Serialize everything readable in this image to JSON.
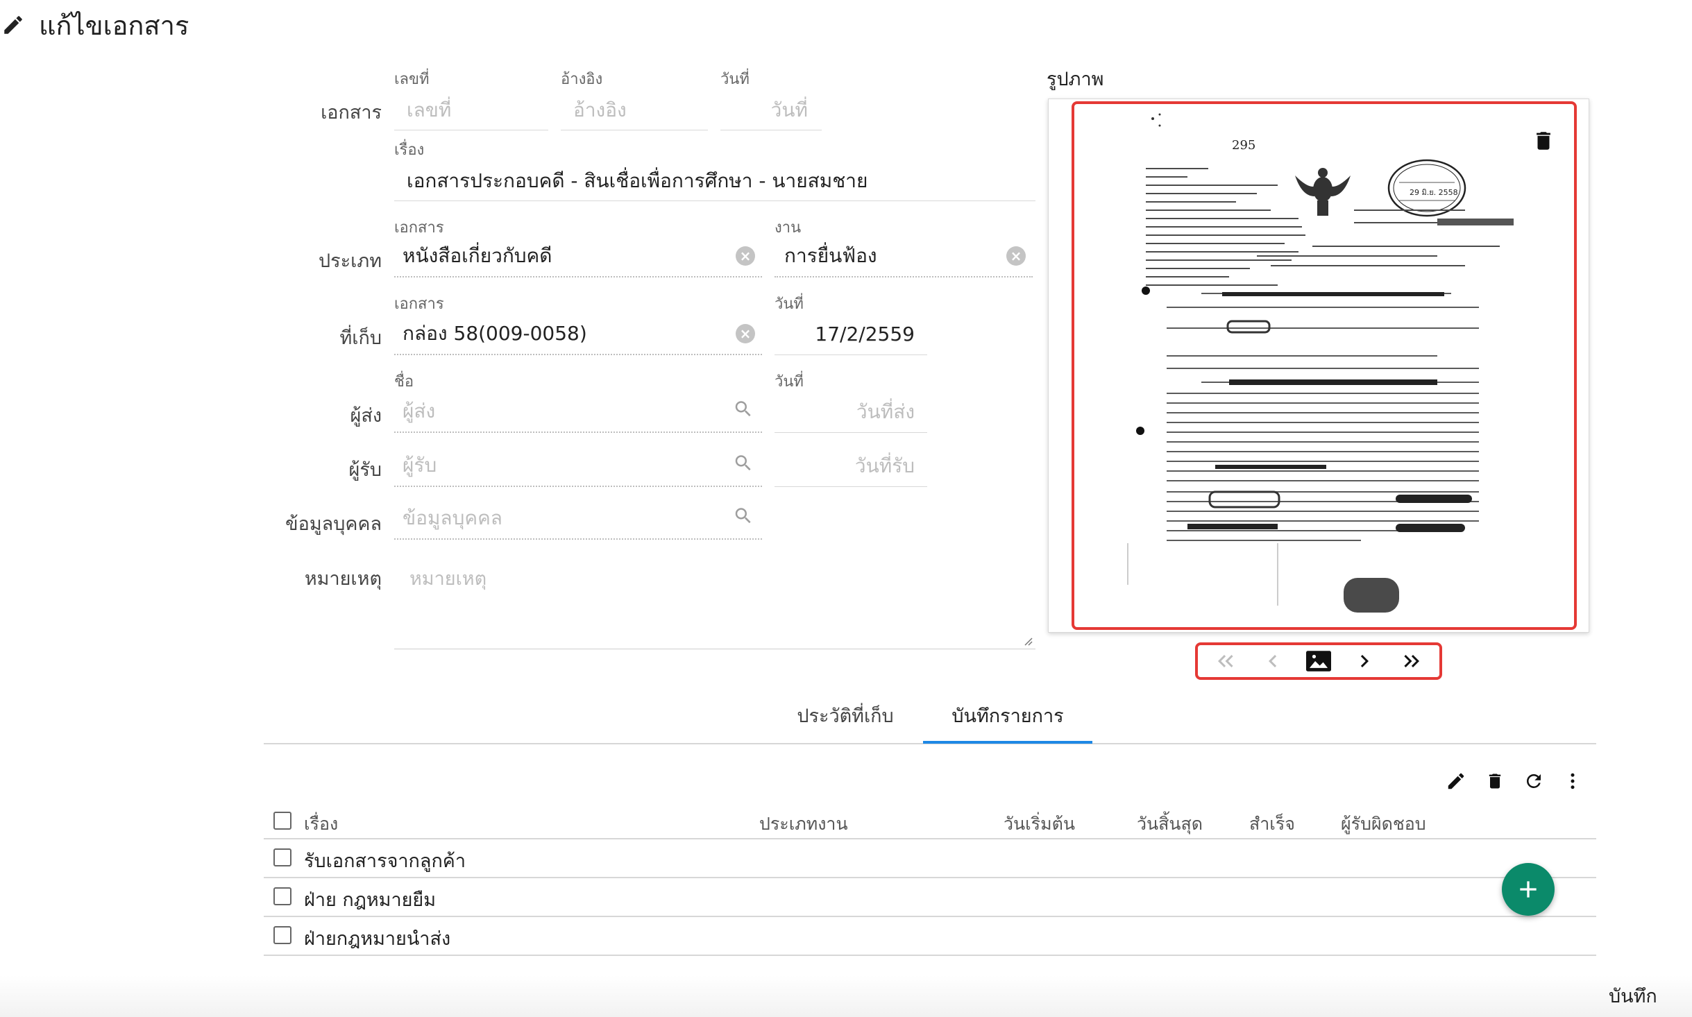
{
  "page": {
    "title": "แก้ไขเอกสาร"
  },
  "form": {
    "document_row": {
      "label": "เอกสาร",
      "number": {
        "label": "เลขที่",
        "placeholder": "เลขที่"
      },
      "reference": {
        "label": "อ้างอิง",
        "placeholder": "อ้างอิง"
      },
      "date": {
        "label": "วันที่",
        "placeholder": "วันที่"
      }
    },
    "subject": {
      "label": "เรื่อง",
      "value": "เอกสารประกอบคดี - สินเชื่อเพื่อการศึกษา - นายสมชาย"
    },
    "type_row": {
      "label": "ประเภท",
      "document": {
        "label": "เอกสาร",
        "value": "หนังสือเกี่ยวกับคดี"
      },
      "work": {
        "label": "งาน",
        "value": "การยื่นฟ้อง"
      }
    },
    "storage_row": {
      "label": "ที่เก็บ",
      "document": {
        "label": "เอกสาร",
        "value": "กล่อง 58(009-0058)"
      },
      "date": {
        "label": "วันที่",
        "value": "17/2/2559"
      }
    },
    "sender_row": {
      "label": "ผู้ส่ง",
      "name": {
        "label": "ชื่อ",
        "placeholder": "ผู้ส่ง"
      },
      "date": {
        "label": "วันที่",
        "placeholder": "วันที่ส่ง"
      }
    },
    "receiver_row": {
      "label": "ผู้รับ",
      "name": {
        "placeholder": "ผู้รับ"
      },
      "date": {
        "placeholder": "วันที่รับ"
      }
    },
    "personal_row": {
      "label": "ข้อมูลบุคคล",
      "placeholder": "ข้อมูลบุคคล"
    },
    "note_row": {
      "label": "หมายเหตุ",
      "placeholder": "หมายเหตุ"
    }
  },
  "image": {
    "label": "รูปภาพ",
    "doc_number": "295",
    "stamp_date": "29 มิ.ย. 2558"
  },
  "tabs": [
    {
      "label": "ประวัติที่เก็บ",
      "active": false
    },
    {
      "label": "บันทึกรายการ",
      "active": true
    }
  ],
  "table": {
    "headers": [
      "เรื่อง",
      "ประเภทงาน",
      "วันเริ่มต้น",
      "วันสิ้นสุด",
      "สำเร็จ",
      "ผู้รับผิดชอบ"
    ],
    "rows": [
      {
        "subject": "รับเอกสารจากลูกค้า"
      },
      {
        "subject": "ฝ่าย กฎหมายยืม"
      },
      {
        "subject": "ฝ่ายกฎหมายนำส่ง"
      }
    ]
  },
  "footer": {
    "save_label": "บันทึก"
  },
  "icons": [
    "edit-icon",
    "clear-icon",
    "search-icon",
    "delete-icon",
    "refresh-icon",
    "more-vert-icon",
    "first-page-icon",
    "prev-page-icon",
    "image-icon",
    "next-page-icon",
    "last-page-icon",
    "add-icon"
  ],
  "colors": {
    "accent": "#1e88e5",
    "highlight": "#e53935",
    "fab": "#0b8a6a"
  }
}
